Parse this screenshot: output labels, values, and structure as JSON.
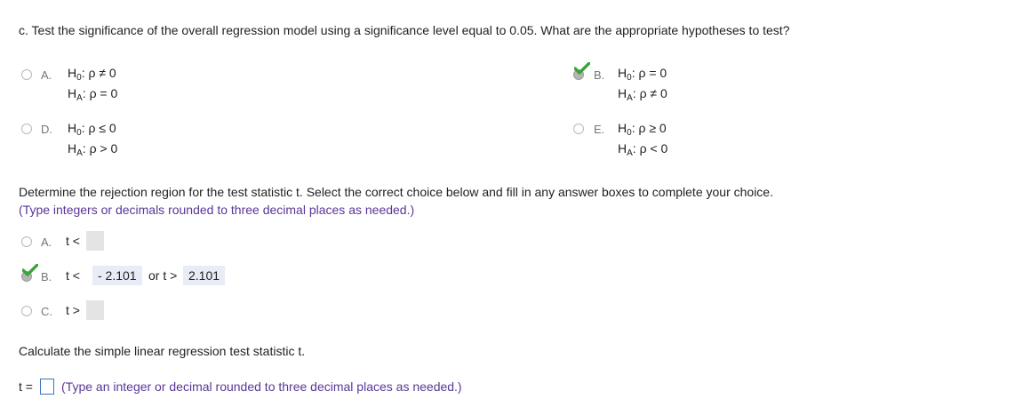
{
  "part_c": {
    "question": "c. Test the significance of the overall regression model using a significance level equal to 0.05. What are the appropriate hypotheses to test?",
    "options": [
      {
        "letter": "A.",
        "h0": "H",
        "h0_sub": "0",
        "h0_rel": ": ρ ≠ 0",
        "ha": "H",
        "ha_sub": "A",
        "ha_rel": ": ρ = 0",
        "selected": false
      },
      {
        "letter": "B.",
        "h0": "H",
        "h0_sub": "0",
        "h0_rel": ": ρ = 0",
        "ha": "H",
        "ha_sub": "A",
        "ha_rel": ": ρ ≠ 0",
        "selected": true,
        "correct": true
      },
      {
        "letter": "D.",
        "h0": "H",
        "h0_sub": "0",
        "h0_rel": ": ρ ≤ 0",
        "ha": "H",
        "ha_sub": "A",
        "ha_rel": ": ρ > 0",
        "selected": false
      },
      {
        "letter": "E.",
        "h0": "H",
        "h0_sub": "0",
        "h0_rel": ": ρ ≥ 0",
        "ha": "H",
        "ha_sub": "A",
        "ha_rel": ": ρ < 0",
        "selected": false
      }
    ]
  },
  "rejection": {
    "prompt": "Determine the rejection region for the test statistic t. Select the correct choice below and fill in any answer boxes to complete your choice.",
    "hint": "(Type integers or decimals rounded to three decimal places as needed.)",
    "options": [
      {
        "letter": "A.",
        "text": "t <",
        "selected": false
      },
      {
        "letter": "B.",
        "text": "t <",
        "value1": "- 2.101",
        "mid": "or t >",
        "value2": "2.101",
        "selected": true,
        "correct": true
      },
      {
        "letter": "C.",
        "text": "t >",
        "selected": false
      }
    ]
  },
  "statistic": {
    "prompt": "Calculate the simple linear regression test statistic t.",
    "label": "t =",
    "value": "",
    "hint": "(Type an integer or decimal rounded to three decimal places as needed.)"
  },
  "colors": {
    "check": "#3aa33a",
    "hint": "#5a3696",
    "answer_bg": "#e7ecf6",
    "box_bg": "#e4e4e4",
    "input_border": "#3b73c2"
  }
}
